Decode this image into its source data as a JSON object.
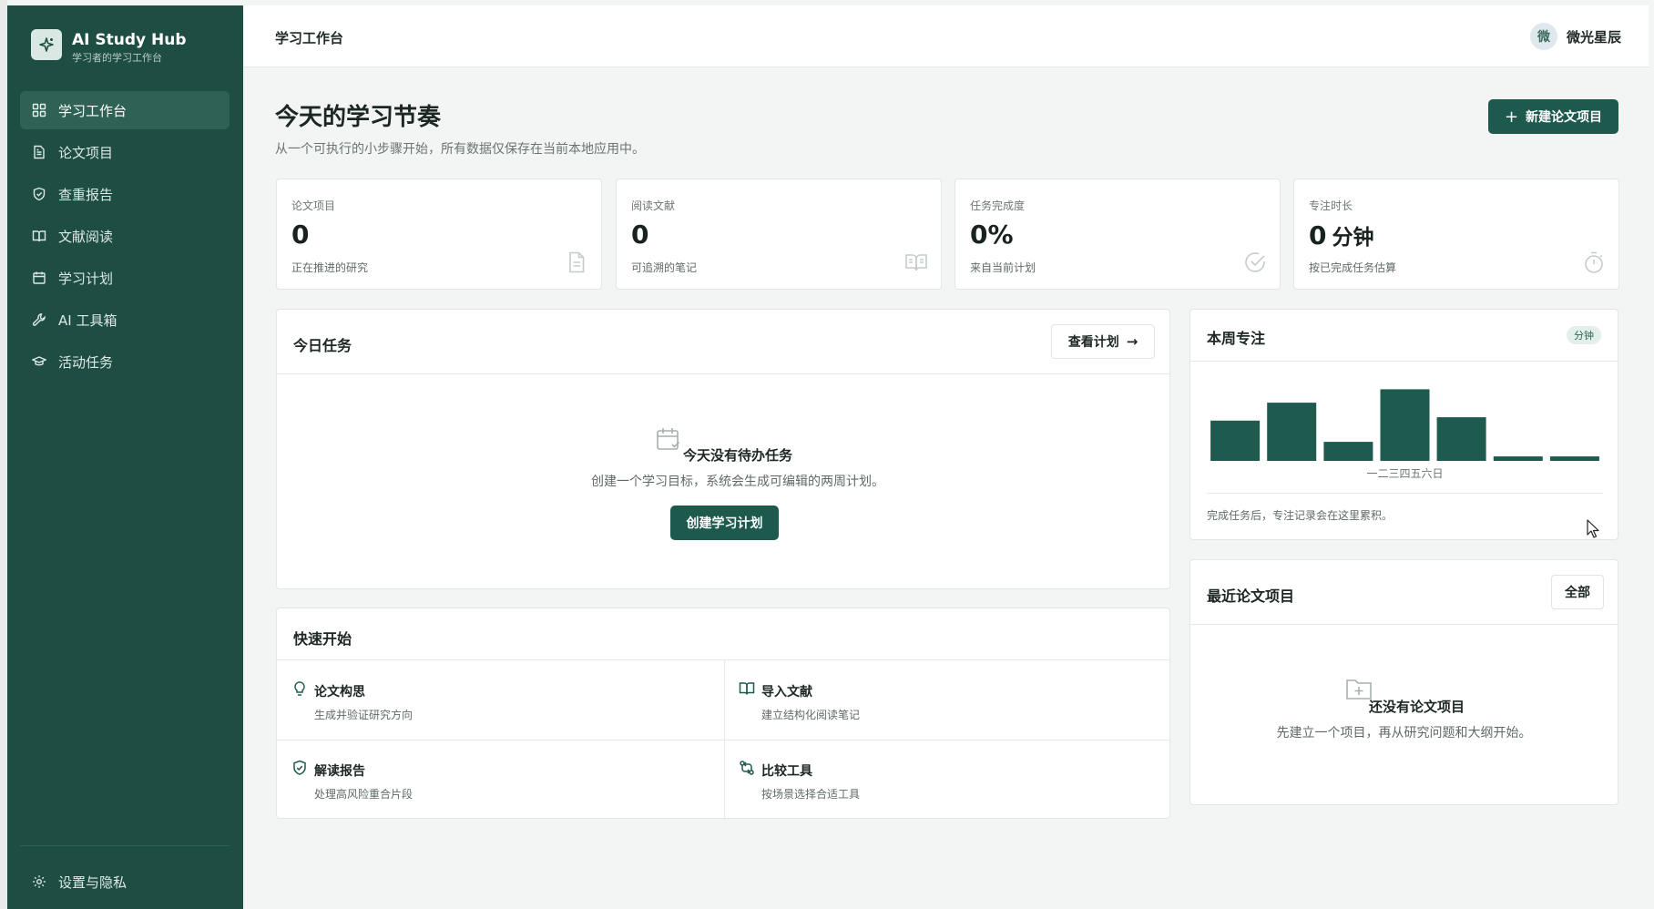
{
  "brand": {
    "title": "AI Study Hub",
    "subtitle": "学习者的学习工作台"
  },
  "sidebar": {
    "items": [
      {
        "label": "学习工作台",
        "icon": "dashboard-icon",
        "active": true
      },
      {
        "label": "论文项目",
        "icon": "document-icon"
      },
      {
        "label": "查重报告",
        "icon": "shield-icon"
      },
      {
        "label": "文献阅读",
        "icon": "book-icon"
      },
      {
        "label": "学习计划",
        "icon": "calendar-icon"
      },
      {
        "label": "AI 工具箱",
        "icon": "wrench-icon"
      },
      {
        "label": "活动任务",
        "icon": "graduation-cap-icon"
      }
    ],
    "settings": {
      "label": "设置与隐私",
      "icon": "gear-icon"
    }
  },
  "topbar": {
    "title": "学习工作台",
    "user_initial": "微",
    "user_name": "微光星辰"
  },
  "page": {
    "title": "今天的学习节奏",
    "subtitle": "从一个可执行的小步骤开始，所有数据仅保存在当前本地应用中。",
    "new_button": "新建论文项目"
  },
  "stats": [
    {
      "label": "论文项目",
      "value": "0",
      "unit": "",
      "sub": "正在推进的研究",
      "icon": "document-icon"
    },
    {
      "label": "阅读文献",
      "value": "0",
      "unit": "",
      "sub": "可追溯的笔记",
      "icon": "open-book-icon"
    },
    {
      "label": "任务完成度",
      "value": "0%",
      "unit": "",
      "sub": "来自当前计划",
      "icon": "check-circle-icon"
    },
    {
      "label": "专注时长",
      "value": "0",
      "unit": "分钟",
      "sub": "按已完成任务估算",
      "icon": "stopwatch-icon"
    }
  ],
  "today_tasks": {
    "title": "今日任务",
    "view_plan": "查看计划",
    "empty_title": "今天没有待办任务",
    "empty_desc": "创建一个学习目标，系统会生成可编辑的两周计划。",
    "create_button": "创建学习计划"
  },
  "quick_start": {
    "title": "快速开始",
    "items": [
      {
        "title": "论文构思",
        "sub": "生成并验证研究方向",
        "icon": "lightbulb-icon"
      },
      {
        "title": "导入文献",
        "sub": "建立结构化阅读笔记",
        "icon": "book-icon"
      },
      {
        "title": "解读报告",
        "sub": "处理高风险重合片段",
        "icon": "shield-check-icon"
      },
      {
        "title": "比较工具",
        "sub": "按场景选择合适工具",
        "icon": "compare-icon"
      }
    ]
  },
  "weekly_focus": {
    "title": "本周专注",
    "badge": "分钟",
    "footnote": "完成任务后，专注记录会在这里累积。"
  },
  "chart_data": {
    "type": "bar",
    "categories": [
      "一",
      "二",
      "三",
      "四",
      "五",
      "六",
      "日"
    ],
    "values": [
      36,
      52,
      17,
      64,
      39,
      4,
      4
    ],
    "title": "",
    "xlabel": "",
    "ylabel": "",
    "ylim": [
      0,
      70
    ],
    "color": "#1e5a4d",
    "grid": false
  },
  "recent_projects": {
    "title": "最近论文项目",
    "all_button": "全部",
    "empty_title": "还没有论文项目",
    "empty_desc": "先建立一个项目，再从研究问题和大纲开始。"
  },
  "colors": {
    "sidebar": "#1d4d43",
    "accent": "#1d5a4d",
    "background": "#f3f4f4"
  }
}
